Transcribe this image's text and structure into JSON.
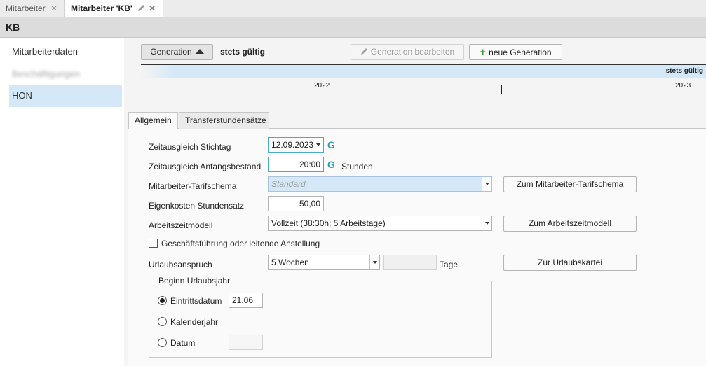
{
  "tabs": [
    {
      "label": "Mitarbeiter"
    },
    {
      "label": "Mitarbeiter 'KB'"
    }
  ],
  "header": {
    "title": "KB"
  },
  "sidebar": {
    "items": [
      {
        "label": "Mitarbeiterdaten"
      },
      {
        "label": "Beschäftigungen"
      },
      {
        "label": "HON"
      }
    ]
  },
  "toolbar": {
    "generation_label": "Generation",
    "validity_label": "stets gültig",
    "edit_generation_label": "Generation bearbeiten",
    "new_generation_label": "neue Generation"
  },
  "timeline": {
    "bar_label": "stets gültig",
    "years": [
      "2022",
      "2023"
    ]
  },
  "content_tabs": [
    {
      "label": "Allgemein"
    },
    {
      "label": "Transferstundensätze"
    }
  ],
  "form": {
    "stichtag_label": "Zeitausgleich Stichtag",
    "stichtag_value": "12.09.2023",
    "g_marker": "G",
    "anfangsbestand_label": "Zeitausgleich Anfangsbestand",
    "anfangsbestand_value": "20:00",
    "anfangsbestand_unit": "Stunden",
    "tarifschema_label": "Mitarbeiter-Tarifschema",
    "tarifschema_placeholder": "Standard",
    "tarifschema_button": "Zum Mitarbeiter-Tarifschema",
    "eigenkosten_label": "Eigenkosten Stundensatz",
    "eigenkosten_value": "50,00",
    "arbeitszeit_label": "Arbeitszeitmodell",
    "arbeitszeit_value": "Vollzeit (38:30h; 5 Arbeitstage)",
    "arbeitszeit_button": "Zum Arbeitszeitmodell",
    "gf_label": "Geschäftsführung oder leitende Anstellung",
    "gf_checked": false,
    "urlaub_label": "Urlaubsanspruch",
    "urlaub_value": "5 Wochen",
    "urlaub_days_value": "",
    "urlaub_unit": "Tage",
    "urlaub_button": "Zur Urlaubskartei",
    "beginn_legend": "Beginn Urlaubsjahr",
    "radio_eintritt": "Eintrittsdatum",
    "radio_eintritt_value": "21.06",
    "radio_kalender": "Kalenderjahr",
    "radio_datum": "Datum",
    "radio_datum_value": "",
    "selected_radio": "Eintrittsdatum"
  },
  "colors": {
    "selection": "#d4e8f8",
    "accent": "#2c9bb8",
    "plus": "#3aa63a"
  },
  "icons": {
    "tab_close": "close-icon",
    "tab_edit": "pencil-icon",
    "gen_toggle": "triangle-up-icon",
    "edit_gen": "pencil-icon",
    "new_gen": "plus-icon"
  }
}
